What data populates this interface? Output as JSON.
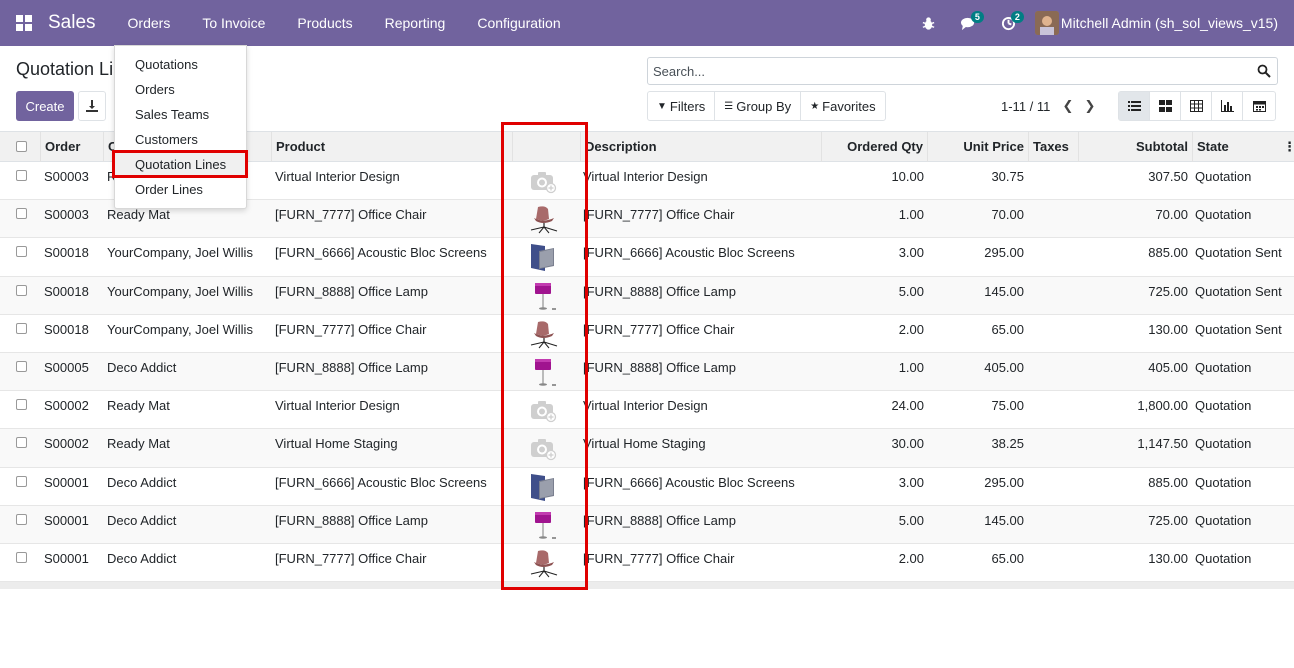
{
  "navbar": {
    "brand": "Sales",
    "menu": [
      "Orders",
      "To Invoice",
      "Products",
      "Reporting",
      "Configuration"
    ],
    "messages_count": "5",
    "activities_count": "2",
    "user": "Mitchell Admin (sh_sol_views_v15)",
    "bg_color": "#71639e"
  },
  "page": {
    "title": "Quotation Li",
    "create_label": "Create",
    "search_placeholder": "Search...",
    "filters_label": "Filters",
    "groupby_label": "Group By",
    "favorites_label": "Favorites",
    "pager": "1-11 / 11"
  },
  "dropdown": {
    "items": [
      "Quotations",
      "Orders",
      "Sales Teams",
      "Customers",
      "Quotation Lines",
      "Order Lines"
    ],
    "active": "Quotation Lines"
  },
  "table": {
    "headers": {
      "order": "Order",
      "customer": "C",
      "product": "Product",
      "description": "Description",
      "qty": "Ordered Qty",
      "price": "Unit Price",
      "taxes": "Taxes",
      "subtotal": "Subtotal",
      "state": "State"
    },
    "rows": [
      {
        "order": "S00003",
        "customer": "R",
        "product": "Virtual Interior Design",
        "image": "camera-placeholder",
        "description": "Virtual Interior Design",
        "qty": "10.00",
        "price": "30.75",
        "subtotal": "307.50",
        "state": "Quotation"
      },
      {
        "order": "S00003",
        "customer": "Ready Mat",
        "product": "[FURN_7777] Office Chair",
        "image": "chair",
        "description": "[FURN_7777] Office Chair",
        "qty": "1.00",
        "price": "70.00",
        "subtotal": "70.00",
        "state": "Quotation"
      },
      {
        "order": "S00018",
        "customer": "YourCompany, Joel Willis",
        "product": "[FURN_6666] Acoustic Bloc Screens",
        "image": "screens",
        "description": "[FURN_6666] Acoustic Bloc Screens",
        "qty": "3.00",
        "price": "295.00",
        "subtotal": "885.00",
        "state": "Quotation Sent"
      },
      {
        "order": "S00018",
        "customer": "YourCompany, Joel Willis",
        "product": "[FURN_8888] Office Lamp",
        "image": "lamp",
        "description": "[FURN_8888] Office Lamp",
        "qty": "5.00",
        "price": "145.00",
        "subtotal": "725.00",
        "state": "Quotation Sent"
      },
      {
        "order": "S00018",
        "customer": "YourCompany, Joel Willis",
        "product": "[FURN_7777] Office Chair",
        "image": "chair",
        "description": "[FURN_7777] Office Chair",
        "qty": "2.00",
        "price": "65.00",
        "subtotal": "130.00",
        "state": "Quotation Sent"
      },
      {
        "order": "S00005",
        "customer": "Deco Addict",
        "product": "[FURN_8888] Office Lamp",
        "image": "lamp",
        "description": "[FURN_8888] Office Lamp",
        "qty": "1.00",
        "price": "405.00",
        "subtotal": "405.00",
        "state": "Quotation"
      },
      {
        "order": "S00002",
        "customer": "Ready Mat",
        "product": "Virtual Interior Design",
        "image": "camera-placeholder",
        "description": "Virtual Interior Design",
        "qty": "24.00",
        "price": "75.00",
        "subtotal": "1,800.00",
        "state": "Quotation"
      },
      {
        "order": "S00002",
        "customer": "Ready Mat",
        "product": "Virtual Home Staging",
        "image": "camera-placeholder",
        "description": "Virtual Home Staging",
        "qty": "30.00",
        "price": "38.25",
        "subtotal": "1,147.50",
        "state": "Quotation"
      },
      {
        "order": "S00001",
        "customer": "Deco Addict",
        "product": "[FURN_6666] Acoustic Bloc Screens",
        "image": "screens",
        "description": "[FURN_6666] Acoustic Bloc Screens",
        "qty": "3.00",
        "price": "295.00",
        "subtotal": "885.00",
        "state": "Quotation"
      },
      {
        "order": "S00001",
        "customer": "Deco Addict",
        "product": "[FURN_8888] Office Lamp",
        "image": "lamp",
        "description": "[FURN_8888] Office Lamp",
        "qty": "5.00",
        "price": "145.00",
        "subtotal": "725.00",
        "state": "Quotation"
      },
      {
        "order": "S00001",
        "customer": "Deco Addict",
        "product": "[FURN_7777] Office Chair",
        "image": "chair",
        "description": "[FURN_7777] Office Chair",
        "qty": "2.00",
        "price": "65.00",
        "subtotal": "130.00",
        "state": "Quotation"
      }
    ]
  },
  "colors": {
    "highlight": "#e00000",
    "badge": "#017e84"
  }
}
